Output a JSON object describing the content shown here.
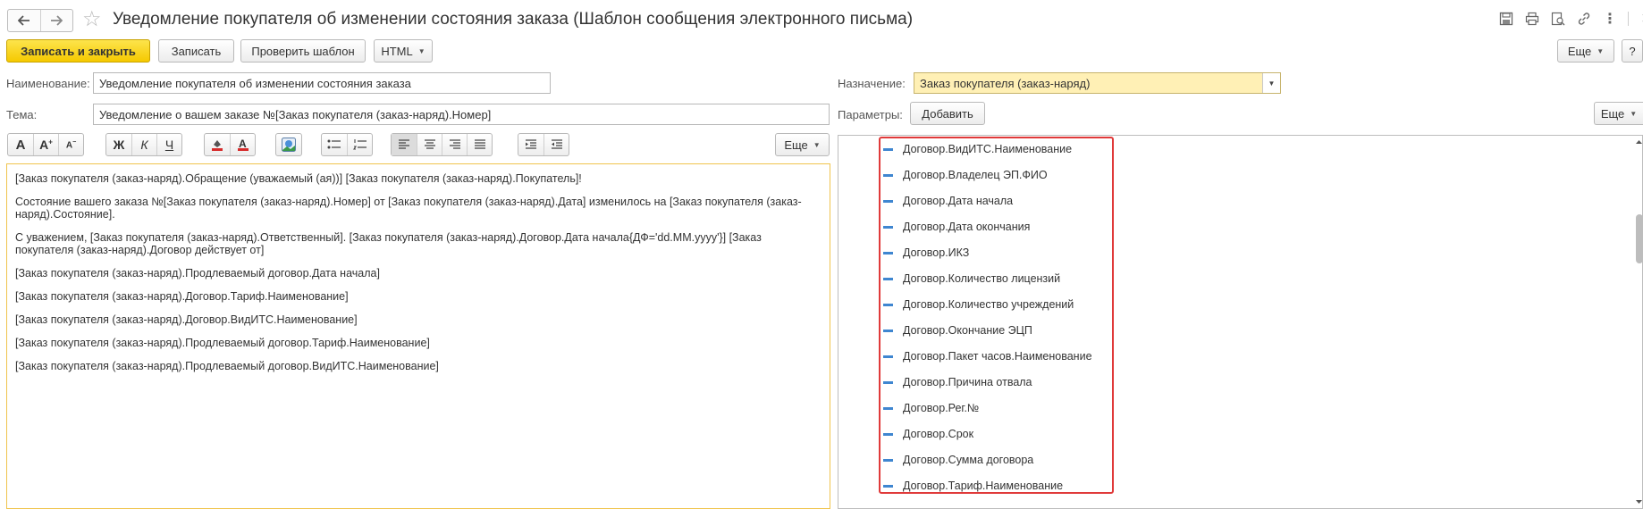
{
  "window": {
    "title": "Уведомление покупателя об изменении состояния заказа (Шаблон сообщения электронного письма)"
  },
  "titlebar_icons": [
    "save-icon",
    "print-icon",
    "preview-icon",
    "link-icon",
    "more-icon",
    "close-icon"
  ],
  "titlebar_more": "⋮",
  "titlebar_close": "×",
  "toolbar": {
    "save_close": "Записать и закрыть",
    "save": "Записать",
    "check_template": "Проверить шаблон",
    "format": "HTML",
    "more": "Еще",
    "help": "?"
  },
  "form": {
    "name_label": "Наименование:",
    "name_value": "Уведомление покупателя об изменении состояния заказа",
    "subject_label": "Тема:",
    "subject_value": "Уведомление о вашем заказе №[Заказ покупателя (заказ-наряд).Номер]",
    "purpose_label": "Назначение:",
    "purpose_value": "Заказ покупателя (заказ-наряд)",
    "params_label": "Параметры:",
    "add_button": "Добавить",
    "params_more": "Еще"
  },
  "format_toolbar": {
    "font_a": "A",
    "bold": "Ж",
    "italic": "К",
    "underline": "Ч",
    "more": "Еще"
  },
  "editor": {
    "lines": [
      "[Заказ покупателя (заказ-наряд).Обращение (уважаемый (ая))] [Заказ покупателя (заказ-наряд).Покупатель]!",
      "Состояние вашего заказа №[Заказ покупателя (заказ-наряд).Номер] от [Заказ покупателя (заказ-наряд).Дата] изменилось на [Заказ покупателя (заказ-наряд).Состояние].",
      "С уважением, [Заказ покупателя (заказ-наряд).Ответственный]. [Заказ покупателя (заказ-наряд).Договор.Дата начала{ДФ='dd.MM.yyyy'}] [Заказ покупателя (заказ-наряд).Договор действует от]",
      "[Заказ покупателя (заказ-наряд).Продлеваемый договор.Дата начала]",
      "[Заказ покупателя (заказ-наряд).Договор.Тариф.Наименование]",
      "[Заказ покупателя (заказ-наряд).Договор.ВидИТС.Наименование]",
      "[Заказ покупателя (заказ-наряд).Продлеваемый договор.Тариф.Наименование]",
      "[Заказ покупателя (заказ-наряд).Продлеваемый договор.ВидИТС.Наименование]"
    ]
  },
  "params_tree": {
    "items": [
      "Договор.ВидИТС.Наименование",
      "Договор.Владелец ЭП.ФИО",
      "Договор.Дата начала",
      "Договор.Дата окончания",
      "Договор.ИКЗ",
      "Договор.Количество лицензий",
      "Договор.Количество учреждений",
      "Договор.Окончание ЭЦП",
      "Договор.Пакет часов.Наименование",
      "Договор.Причина отвала",
      "Договор.Рег.№",
      "Договор.Срок",
      "Договор.Сумма договора",
      "Договор.Тариф.Наименование"
    ]
  },
  "colors": {
    "primary_button": "#f5c900",
    "purpose_field_bg": "#fff0b5",
    "editor_border": "#f0c44d",
    "highlight_border": "#e03a3a",
    "tree_marker": "#3f86d0"
  }
}
